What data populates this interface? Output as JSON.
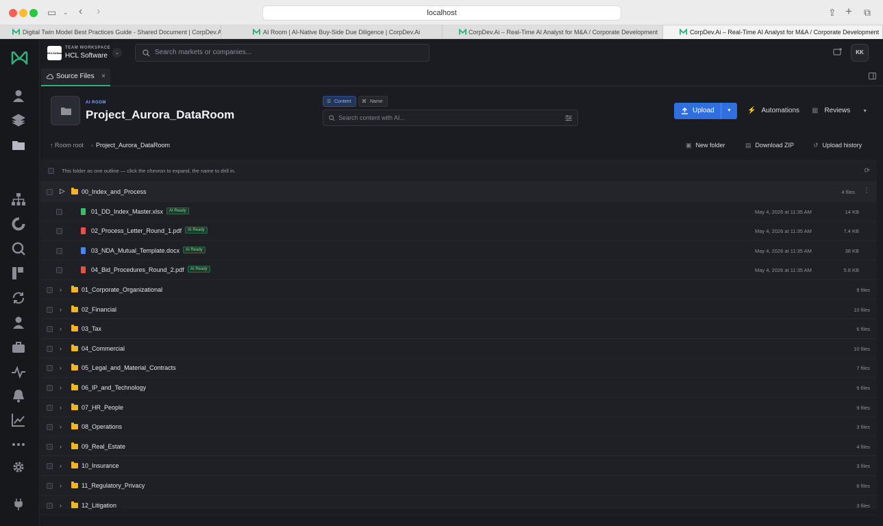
{
  "browser": {
    "url": "localhost",
    "tabs": [
      {
        "title": "Digital Twin Model Best Practices Guide - Shared Document | CorpDev.AI"
      },
      {
        "title": "AI Room | AI-Native Buy-Side Due Diligence | CorpDev.Ai"
      },
      {
        "title": "CorpDev.Ai – Real-Time AI Analyst for M&A / Corporate Development"
      },
      {
        "title": "CorpDev.Ai – Real-Time AI Analyst for M&A / Corporate Development"
      }
    ]
  },
  "workspace": {
    "label": "TEAM WORKSPACE",
    "name": "HCL Software",
    "logo_text": "HCLSoftware"
  },
  "search": {
    "placeholder": "Search markets or companies..."
  },
  "user": {
    "initials": "KK"
  },
  "source_tab": {
    "label": "Source Files",
    "close": "×"
  },
  "room": {
    "badge": "AI ROOM",
    "title": "Project_Aurora_DataRoom"
  },
  "toggle": {
    "content": "Content",
    "name": "Name"
  },
  "ai_search": {
    "placeholder": "Search content with AI..."
  },
  "actions": {
    "upload": "Upload",
    "automations": "Automations",
    "reviews": "Reviews",
    "new_folder": "New folder",
    "download_zip": "Download ZIP",
    "upload_history": "Upload history"
  },
  "breadcrumb": {
    "root": "Room root",
    "current": "Project_Aurora_DataRoom"
  },
  "info": "This folder as one outline — click the chevron to expand, the name to drill in.",
  "expanded": {
    "name": "00_Index_and_Process",
    "count": "4 files",
    "files": [
      {
        "name": "01_DD_Index_Master.xlsx",
        "badge": "AI Ready",
        "date": "May 4, 2026 at 11:35 AM",
        "size": "14 KB",
        "color": "#3fb96b"
      },
      {
        "name": "02_Process_Letter_Round_1.pdf",
        "badge": "AI Ready",
        "date": "May 4, 2026 at 11:35 AM",
        "size": "7.4 KB",
        "color": "#e0544e"
      },
      {
        "name": "03_NDA_Mutual_Template.docx",
        "badge": "AI Ready",
        "date": "May 4, 2026 at 11:35 AM",
        "size": "38 KB",
        "color": "#4a86e8"
      },
      {
        "name": "04_Bid_Procedures_Round_2.pdf",
        "badge": "AI Ready",
        "date": "May 4, 2026 at 11:35 AM",
        "size": "5.8 KB",
        "color": "#e0544e"
      }
    ]
  },
  "folders": [
    {
      "name": "01_Corporate_Organizational",
      "count": "9 files"
    },
    {
      "name": "02_Financial",
      "count": "10 files"
    },
    {
      "name": "03_Tax",
      "count": "6 files"
    },
    {
      "name": "04_Commercial",
      "count": "10 files"
    },
    {
      "name": "05_Legal_and_Material_Contracts",
      "count": "7 files"
    },
    {
      "name": "06_IP_and_Technology",
      "count": "9 files"
    },
    {
      "name": "07_HR_People",
      "count": "9 files"
    },
    {
      "name": "08_Operations",
      "count": "3 files"
    },
    {
      "name": "09_Real_Estate",
      "count": "4 files"
    },
    {
      "name": "10_Insurance",
      "count": "3 files"
    },
    {
      "name": "11_Regulatory_Privacy",
      "count": "6 files"
    },
    {
      "name": "12_Litigation",
      "count": "3 files"
    }
  ]
}
